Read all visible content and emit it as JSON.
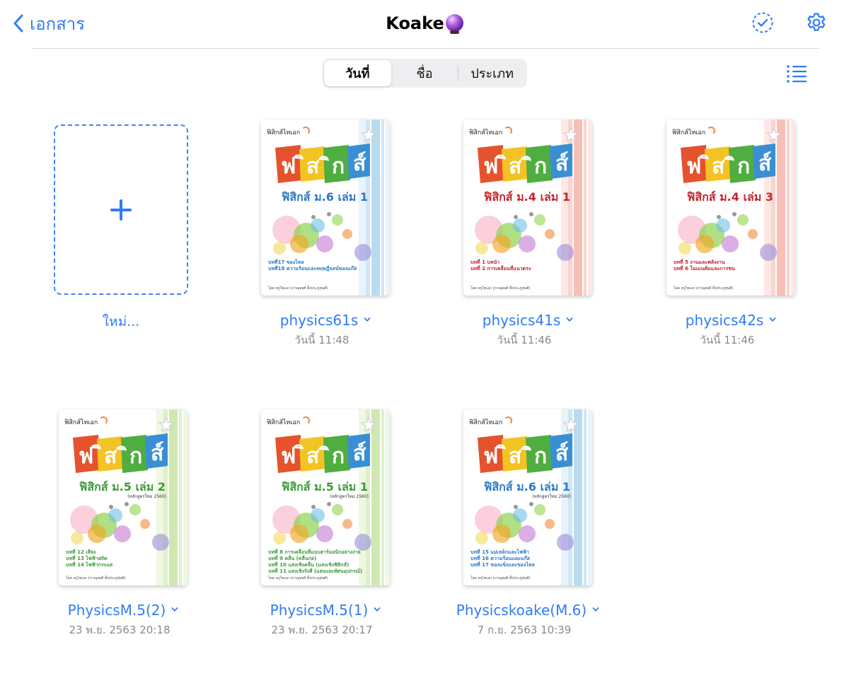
{
  "header": {
    "back_label": "เอกสาร",
    "title": "Koake",
    "title_emoji_icon": "crystal-ball-icon",
    "select_icon": "checkmark-circle-dashed-icon",
    "settings_icon": "gear-icon"
  },
  "sort": {
    "options": [
      "วันที่",
      "ชื่อ",
      "ประเภท"
    ],
    "selected": "วันที่"
  },
  "view_toggle_icon": "list-view-icon",
  "accent_color": "#2f7cf6",
  "new_item": {
    "label": "ใหม่..."
  },
  "documents": [
    {
      "name": "physics61s",
      "date": "วันนี้ 11:48",
      "cover": {
        "brand": "ฟิสิกส์ไทเอก",
        "subtitle": "ฟิสิกส์ ม.6 เล่ม 1",
        "curriculum": "",
        "theme_color": "#2a79c2",
        "chapters": [
          "บทที่17 ของไหล",
          "บทที่18 ความร้อนและทฤษฎีจลน์ของแก๊ส"
        ],
        "author": "โดย ครูไทเอก (ภาณุพงศ์ ทั้งประภูหุ่นศ์)"
      }
    },
    {
      "name": "physics41s",
      "date": "วันนี้ 11:46",
      "cover": {
        "brand": "ฟิสิกส์ไทเอก",
        "subtitle": "ฟิสิกส์ ม.4 เล่ม 1",
        "curriculum": "",
        "theme_color": "#c4242b",
        "chapters": [
          "บทที่ 1 บทนำ",
          "บทที่ 2 การเคลื่อนที่แนวตรง"
        ],
        "author": "โดย ครูไทเอก (ภาณุพงศ์ ทั้งประภูหุ่นศ์)"
      }
    },
    {
      "name": "physics42s",
      "date": "วันนี้ 11:46",
      "cover": {
        "brand": "ฟิสิกส์ไทเอก",
        "subtitle": "ฟิสิกส์ ม.4 เล่ม 3",
        "curriculum": "",
        "theme_color": "#c4242b",
        "chapters": [
          "บทที่ 5 งานและพลังงาน",
          "บทที่ 6 โมเมนตัมและการชน"
        ],
        "author": "โดย ครูไทเอก (ภาณุพงศ์ ทั้งประภูหุ่นศ์)"
      }
    },
    {
      "name": "PhysicsM.5(2)",
      "date": "23 พ.ย. 2563 20:18",
      "cover": {
        "brand": "ฟิสิกส์ไทเอก",
        "subtitle": "ฟิสิกส์ ม.5 เล่ม 2",
        "curriculum": "(หลักสูตรใหม่ 2560)",
        "theme_color": "#3a9a3a",
        "chapters": [
          "บทที่ 12 เสียง",
          "บทที่ 13 ไฟฟ้าสถิต",
          "บทที่ 14 ไฟฟ้ากระแส"
        ],
        "author": "โดย ครูไทเอก (ภาณุพงศ์ ทั้งประภูหุ่นศ์)"
      }
    },
    {
      "name": "PhysicsM.5(1)",
      "date": "23 พ.ย. 2563 20:17",
      "cover": {
        "brand": "ฟิสิกส์ไทเอก",
        "subtitle": "ฟิสิกส์ ม.5 เล่ม 1",
        "curriculum": "(หลักสูตรใหม่ 2560)",
        "theme_color": "#3a9a3a",
        "chapters": [
          "บทที่ 8 การเคลื่อนที่แบบฮาร์มอนิกอย่างง่าย",
          "บทที่ 9 คลื่น (คลื่นกล)",
          "บทที่ 10 แสงเชิงคลื่น (แสงเชิงฟิสิกส์)",
          "บทที่ 11 แสงเชิงรังสี (แสงและทัศนอุปกรณ์)"
        ],
        "author": "โดย ครูไทเอก (ภาณุพงศ์ ทั้งประภูหุ่นศ์)"
      }
    },
    {
      "name": "Physicskoake(M.6)",
      "date": "7 ก.ย. 2563 10:39",
      "cover": {
        "brand": "ฟิสิกส์ไทเอก",
        "subtitle": "ฟิสิกส์ ม.6 เล่ม 1",
        "curriculum": "(หลักสูตรใหม่ 2560)",
        "theme_color": "#2a79c2",
        "chapters": [
          "บทที่ 15 แม่เหล็กและไฟฟ้า",
          "บทที่ 16 ความร้อนและแก๊ส",
          "บทที่ 17 ของแข็งและของไหล"
        ],
        "author": "โดย ครูไทเอก (ภาณุพงศ์ ทั้งประภูหุ่นศ์)"
      }
    }
  ]
}
